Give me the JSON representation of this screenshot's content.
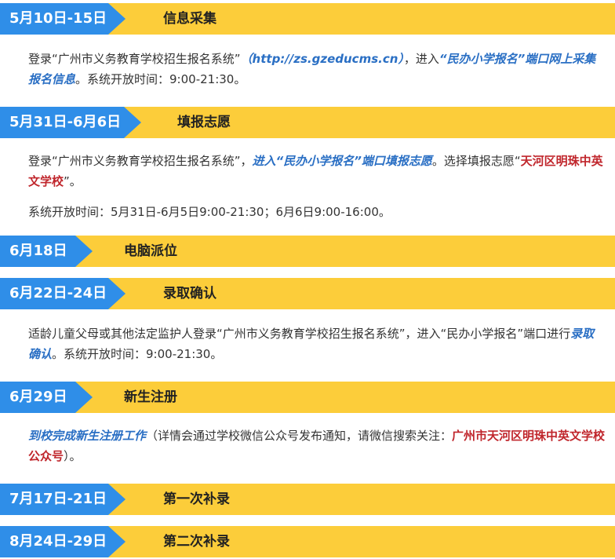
{
  "sections": [
    {
      "date": "5月10日-15日",
      "title": "信息采集"
    },
    {
      "date": "5月31日-6月6日",
      "title": "填报志愿"
    },
    {
      "date": "6月18日",
      "title": "电脑派位"
    },
    {
      "date": "6月22日-24日",
      "title": "录取确认"
    },
    {
      "date": "6月29日",
      "title": "新生注册"
    },
    {
      "date": "7月17日-21日",
      "title": "第一次补录"
    },
    {
      "date": "8月24日-29日",
      "title": "第二次补录"
    }
  ],
  "p1": {
    "a": "登录“广州市义务教育学校招生报名系统”",
    "url": "（http://zs.gzeducms.cn）",
    "b": "，进入",
    "c": "“民办小学报名”端口网上采集报名信息",
    "d": "。系统开放时间：9:00-21:30。"
  },
  "p2": {
    "a": "登录“广州市义务教育学校招生报名系统”，",
    "b": "进入“民办小学报名”端口填报志愿",
    "c": "。选择填报志愿“",
    "d": "天河区明珠中英文学校",
    "e": "”。",
    "f": "系统开放时间：5月31日-6月5日9:00-21:30；6月6日9:00-16:00。"
  },
  "p3": {
    "a": "适龄儿童父母或其他法定监护人登录“广州市义务教育学校招生报名系统”，进入“民办小学报名”端口进行",
    "b": "录取确认",
    "c": "。系统开放时间：9:00-21:30。"
  },
  "p4": {
    "a": "到校完成新生注册工作",
    "b": "（详情会通过学校微信公众号发布通知，请微信搜索关注：",
    "c": "广州市天河区明珠中英文学校公众号",
    "d": "）。"
  }
}
